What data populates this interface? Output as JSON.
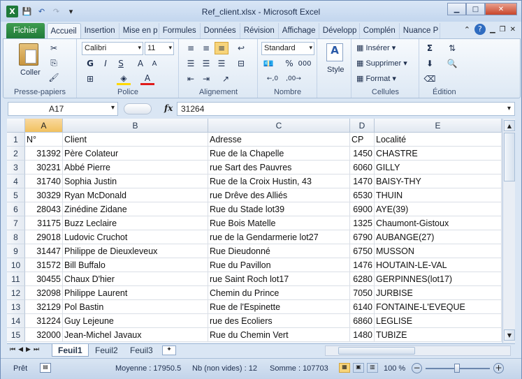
{
  "window": {
    "title": "Ref_client.xlsx - Microsoft Excel"
  },
  "qat": {
    "logo": "X",
    "save": "💾",
    "undo": "↶",
    "redo": "↷",
    "custom": "▾"
  },
  "tabs": [
    {
      "label": "Fichier"
    },
    {
      "label": "Accueil"
    },
    {
      "label": "Insertion"
    },
    {
      "label": "Mise en p"
    },
    {
      "label": "Formules"
    },
    {
      "label": "Données"
    },
    {
      "label": "Révision"
    },
    {
      "label": "Affichage"
    },
    {
      "label": "Développ"
    },
    {
      "label": "Complén"
    },
    {
      "label": "Nuance P"
    }
  ],
  "ribbon": {
    "clipboard": {
      "paste": "Coller",
      "label": "Presse-papiers"
    },
    "font": {
      "name": "Calibri",
      "size": "11",
      "label": "Police",
      "bold": "G",
      "italic": "I",
      "underline": "S"
    },
    "alignment": {
      "label": "Alignement"
    },
    "number": {
      "format": "Standard",
      "label": "Nombre",
      "percent": "%",
      "thousands": "000"
    },
    "style": {
      "label": "Style"
    },
    "cells": {
      "insert": "Insérer",
      "delete": "Supprimer",
      "format": "Format",
      "label": "Cellules"
    },
    "editing": {
      "label": "Édition"
    }
  },
  "formula_bar": {
    "name_box": "A17",
    "fx": "fx",
    "value": "31264"
  },
  "columns": [
    {
      "letter": "A"
    },
    {
      "letter": "B"
    },
    {
      "letter": "C"
    },
    {
      "letter": "D"
    },
    {
      "letter": "E"
    }
  ],
  "rows": [
    {
      "n": "1",
      "a": "N°",
      "b": "Client",
      "c": "Adresse",
      "d": "CP",
      "e": "Localité"
    },
    {
      "n": "2",
      "a": "31392",
      "b": "Père Colateur",
      "c": "Rue de la Chapelle",
      "d": "1450",
      "e": "CHASTRE"
    },
    {
      "n": "3",
      "a": "30231",
      "b": "Abbé Pierre",
      "c": "rue Sart des Pauvres",
      "d": "6060",
      "e": "GILLY"
    },
    {
      "n": "4",
      "a": "31740",
      "b": "Sophia Justin",
      "c": "Rue de la Croix Hustin, 43",
      "d": "1470",
      "e": "BAISY-THY"
    },
    {
      "n": "5",
      "a": "30329",
      "b": "Ryan McDonald",
      "c": "rue Drêve des Alliés",
      "d": "6530",
      "e": "THUIN"
    },
    {
      "n": "6",
      "a": "28043",
      "b": "Zinédine Zidane",
      "c": "Rue du Stade lot39",
      "d": "6900",
      "e": "AYE(39)"
    },
    {
      "n": "7",
      "a": "31175",
      "b": "Buzz Leclaire",
      "c": "Rue Bois Matelle",
      "d": "1325",
      "e": "Chaumont-Gistoux"
    },
    {
      "n": "8",
      "a": "29018",
      "b": "Ludovic Cruchot",
      "c": "rue de la Gendarmerie lot27",
      "d": "6790",
      "e": "AUBANGE(27)"
    },
    {
      "n": "9",
      "a": "31447",
      "b": "Philippe de Dieuxleveux",
      "c": "Rue Dieudonné",
      "d": "6750",
      "e": "MUSSON"
    },
    {
      "n": "10",
      "a": "31572",
      "b": "Bill Buffalo",
      "c": "Rue du Pavillon",
      "d": "1476",
      "e": "HOUTAIN-LE-VAL"
    },
    {
      "n": "11",
      "a": "30455",
      "b": "Chaux D'hier",
      "c": "rue Saint Roch lot17",
      "d": "6280",
      "e": "GERPINNES(lot17)"
    },
    {
      "n": "12",
      "a": "32098",
      "b": "Philippe Laurent",
      "c": "Chemin du Prince",
      "d": "7050",
      "e": "JURBISE"
    },
    {
      "n": "13",
      "a": "32129",
      "b": "Pol Bastin",
      "c": "Rue de l'Espinette",
      "d": "6140",
      "e": "FONTAINE-L'EVEQUE"
    },
    {
      "n": "14",
      "a": "31224",
      "b": "Guy Lejeune",
      "c": "rue des Ecoliers",
      "d": "6860",
      "e": "LEGLISE"
    },
    {
      "n": "15",
      "a": "32000",
      "b": "Jean-Michel Javaux",
      "c": "Rue du Chemin Vert",
      "d": "1480",
      "e": "TUBIZE"
    }
  ],
  "sheets": [
    {
      "label": "Feuil1"
    },
    {
      "label": "Feuil2"
    },
    {
      "label": "Feuil3"
    }
  ],
  "status": {
    "ready": "Prêt",
    "average": "Moyenne : 17950.5",
    "count": "Nb (non vides) : 12",
    "sum": "Somme : 107703",
    "zoom": "100 %"
  }
}
